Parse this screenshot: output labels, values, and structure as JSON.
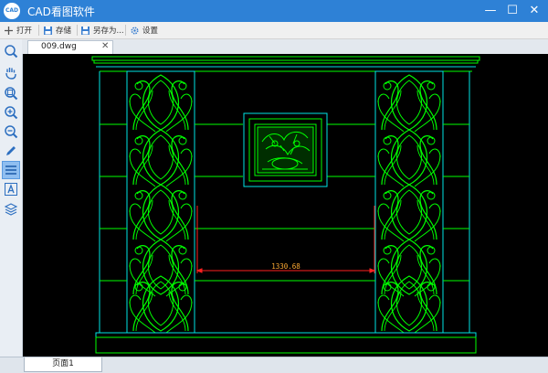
{
  "app": {
    "title": "CAD看图软件",
    "icon_text": "CAD"
  },
  "window_controls": {
    "minimize": "—",
    "maximize": "☐",
    "close": "✕"
  },
  "toolbar": {
    "open_label": "打开",
    "save_label": "存储",
    "save_as_label": "另存为...",
    "settings_label": "设置"
  },
  "tools": [
    "zoom-icon",
    "pan-hand-icon",
    "zoom-window-icon",
    "zoom-in-icon",
    "zoom-out-icon",
    "pen-icon",
    "layers-icon",
    "text-icon",
    "layer-stack-icon"
  ],
  "document": {
    "tab_name": "009.dwg",
    "close": "✕"
  },
  "drawing": {
    "dimension_value": "1330.68",
    "line_color": "#00ff00",
    "edge_color": "#00e5e5",
    "dimension_color": "#ff2020",
    "dimension_text_color": "#ffaa33",
    "background": "#000000"
  },
  "pages": {
    "current": "页面1"
  },
  "colors": {
    "titlebar": "#2e81d6",
    "toolbar": "#f0f0f0",
    "active_tool": "#8fbef0"
  }
}
